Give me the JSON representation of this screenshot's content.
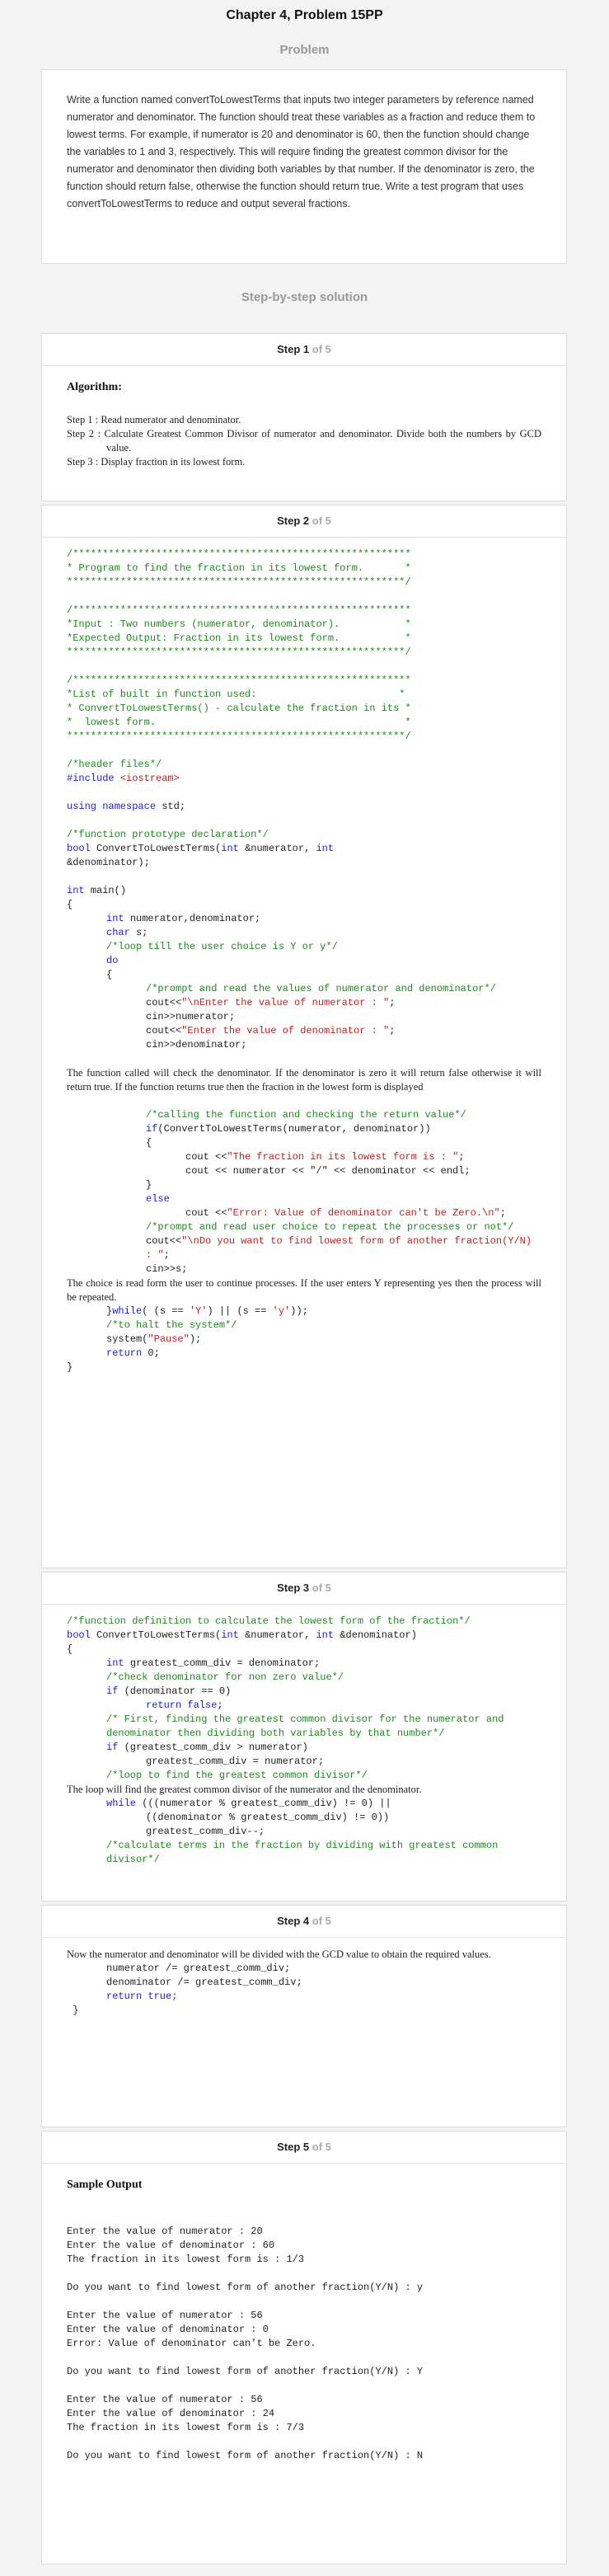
{
  "page_title": "Chapter 4, Problem 15PP",
  "problem_heading": "Problem",
  "problem_text": "Write a function named convertToLowestTerms that inputs two integer parameters by reference named numerator and denominator. The function should treat these variables as a fraction and reduce them to lowest terms. For example, if numerator is 20 and denominator is 60, then the function should change the variables to 1 and 3, respectively. This will require finding the greatest common divisor for the numerator and denominator then dividing both variables by that number. If the denominator is zero, the function should return false, otherwise the function should return true. Write a test program that uses convertToLowestTerms to reduce and output several fractions.",
  "solution_heading": "Step-by-step solution",
  "step_label": "Step",
  "steps": [
    {
      "number": "1",
      "of": "of 5",
      "blocks": [
        {
          "kind": "heading",
          "text": "Algorithm:"
        },
        {
          "kind": "gap"
        },
        {
          "kind": "para",
          "text": "Step 1 : Read numerator and denominator."
        },
        {
          "kind": "para",
          "text": "Step 2 : Calculate Greatest Common Divisor of numerator and denominator. Divide both the numbers by GCD value.",
          "hang": true
        },
        {
          "kind": "para",
          "text": "Step 3 : Display fraction in its lowest form."
        }
      ]
    },
    {
      "number": "2",
      "of": "of 5",
      "blocks": [
        {
          "kind": "code",
          "cls": "c",
          "text": "/*********************************************************"
        },
        {
          "kind": "code",
          "cls": "c",
          "text": "* Program to find the fraction in its lowest form.       *"
        },
        {
          "kind": "code",
          "cls": "c",
          "text": "*********************************************************/"
        },
        {
          "kind": "gap"
        },
        {
          "kind": "code",
          "cls": "c",
          "text": "/*********************************************************"
        },
        {
          "kind": "code",
          "cls": "c",
          "text": "*Input : Two numbers (numerator, denominator).           *"
        },
        {
          "kind": "code",
          "cls": "c",
          "text": "*Expected Output: Fraction in its lowest form.           *"
        },
        {
          "kind": "code",
          "cls": "c",
          "text": "*********************************************************/"
        },
        {
          "kind": "gap"
        },
        {
          "kind": "code",
          "cls": "c",
          "text": "/*********************************************************"
        },
        {
          "kind": "code",
          "cls": "c",
          "text": "*List of built in function used:                        *"
        },
        {
          "kind": "code",
          "cls": "c",
          "text": "* ConvertToLowestTerms() - calculate the fraction in its *"
        },
        {
          "kind": "code",
          "cls": "c",
          "text": "*  lowest form.                                          *"
        },
        {
          "kind": "code",
          "cls": "c",
          "text": "*********************************************************/"
        },
        {
          "kind": "gap"
        },
        {
          "kind": "code",
          "cls": "c",
          "text": "/*header files*/"
        },
        {
          "kind": "code",
          "segs": [
            {
              "cls": "k",
              "text": "#include "
            },
            {
              "cls": "s",
              "text": "<iostream>"
            }
          ]
        },
        {
          "kind": "gap"
        },
        {
          "kind": "code",
          "segs": [
            {
              "cls": "k",
              "text": "using namespace "
            },
            {
              "cls": "n",
              "text": "std;"
            }
          ]
        },
        {
          "kind": "gap"
        },
        {
          "kind": "code",
          "cls": "c",
          "text": "/*function prototype declaration*/"
        },
        {
          "kind": "code",
          "segs": [
            {
              "cls": "k",
              "text": "bool "
            },
            {
              "cls": "n",
              "text": "ConvertToLowestTerms("
            },
            {
              "cls": "k",
              "text": "int "
            },
            {
              "cls": "n",
              "text": "&numerator, "
            },
            {
              "cls": "k",
              "text": "int"
            }
          ]
        },
        {
          "kind": "code",
          "cls": "n",
          "text": "&denominator);"
        },
        {
          "kind": "gap"
        },
        {
          "kind": "code",
          "segs": [
            {
              "cls": "k",
              "text": "int "
            },
            {
              "cls": "n",
              "text": "main()"
            }
          ]
        },
        {
          "kind": "code",
          "cls": "n",
          "text": "{"
        },
        {
          "kind": "code",
          "indent": 1,
          "segs": [
            {
              "cls": "k",
              "text": "int "
            },
            {
              "cls": "n",
              "text": "numerator,denominator;"
            }
          ]
        },
        {
          "kind": "code",
          "indent": 1,
          "segs": [
            {
              "cls": "k",
              "text": "char "
            },
            {
              "cls": "n",
              "text": "s;"
            }
          ]
        },
        {
          "kind": "code",
          "indent": 1,
          "cls": "c",
          "text": "/*loop till the user choice is Y or y*/"
        },
        {
          "kind": "code",
          "indent": 1,
          "cls": "k",
          "text": "do"
        },
        {
          "kind": "code",
          "indent": 1,
          "cls": "n",
          "text": "{"
        },
        {
          "kind": "code",
          "indent": 2,
          "cls": "c",
          "text": "/*prompt and read the values of numerator and denominator*/"
        },
        {
          "kind": "code",
          "indent": 2,
          "segs": [
            {
              "cls": "n",
              "text": "cout<<"
            },
            {
              "cls": "s",
              "text": "\"\\nEnter the value of numerator : \""
            },
            {
              "cls": "n",
              "text": ";"
            }
          ]
        },
        {
          "kind": "code",
          "indent": 2,
          "cls": "n",
          "text": "cin>>numerator;"
        },
        {
          "kind": "code",
          "indent": 2,
          "segs": [
            {
              "cls": "n",
              "text": "cout<<"
            },
            {
              "cls": "s",
              "text": "\"Enter the value of denominator : \""
            },
            {
              "cls": "n",
              "text": ";"
            }
          ]
        },
        {
          "kind": "code",
          "indent": 2,
          "cls": "n",
          "text": "cin>>denominator;"
        },
        {
          "kind": "gap"
        },
        {
          "kind": "para",
          "text": "The function called will check the denominator. If the denominator is zero it will return false otherwise it will return true. If the function returns true then the fraction in the lowest form is displayed"
        },
        {
          "kind": "gap"
        },
        {
          "kind": "code",
          "indent": 2,
          "cls": "c",
          "text": "/*calling the function and checking the return value*/"
        },
        {
          "kind": "code",
          "indent": 2,
          "segs": [
            {
              "cls": "k",
              "text": "if"
            },
            {
              "cls": "n",
              "text": "(ConvertToLowestTerms(numerator, denominator))"
            }
          ]
        },
        {
          "kind": "code",
          "indent": 2,
          "cls": "n",
          "text": "{"
        },
        {
          "kind": "code",
          "indent": 3,
          "segs": [
            {
              "cls": "n",
              "text": "cout <<"
            },
            {
              "cls": "s",
              "text": "\"The fraction in its lowest form is : \""
            },
            {
              "cls": "n",
              "text": ";"
            }
          ]
        },
        {
          "kind": "code",
          "indent": 3,
          "cls": "n",
          "text": "cout << numerator << \"/\" << denominator << endl;"
        },
        {
          "kind": "code",
          "indent": 2,
          "cls": "n",
          "text": "}"
        },
        {
          "kind": "code",
          "indent": 2,
          "cls": "k",
          "text": "else"
        },
        {
          "kind": "code",
          "indent": 3,
          "segs": [
            {
              "cls": "n",
              "text": "cout <<"
            },
            {
              "cls": "s",
              "text": "\"Error: Value of denominator can't be Zero.\\n\""
            },
            {
              "cls": "n",
              "text": ";"
            }
          ]
        },
        {
          "kind": "code",
          "indent": 2,
          "cls": "c",
          "text": "/*prompt and read user choice to repeat the processes or not*/"
        },
        {
          "kind": "code",
          "indent": 2,
          "segs": [
            {
              "cls": "n",
              "text": "cout<<"
            },
            {
              "cls": "s",
              "text": "\"\\nDo you want to find lowest form of another fraction(Y/N) : \""
            },
            {
              "cls": "n",
              "text": ";"
            }
          ]
        },
        {
          "kind": "code",
          "indent": 2,
          "cls": "n",
          "text": "cin>>s;"
        },
        {
          "kind": "para",
          "text": "The choice is read form the user to continue processes. If the user enters Y representing yes then the process will be repeated."
        },
        {
          "kind": "code",
          "indent": 1,
          "segs": [
            {
              "cls": "n",
              "text": "}"
            },
            {
              "cls": "k",
              "text": "while"
            },
            {
              "cls": "n",
              "text": "( (s == "
            },
            {
              "cls": "s",
              "text": "'Y'"
            },
            {
              "cls": "n",
              "text": ") || (s == "
            },
            {
              "cls": "s",
              "text": "'y'"
            },
            {
              "cls": "n",
              "text": "));"
            }
          ]
        },
        {
          "kind": "code",
          "indent": 1,
          "cls": "c",
          "text": "/*to halt the system*/"
        },
        {
          "kind": "code",
          "indent": 1,
          "segs": [
            {
              "cls": "n",
              "text": "system("
            },
            {
              "cls": "s",
              "text": "\"Pause\""
            },
            {
              "cls": "n",
              "text": ");"
            }
          ]
        },
        {
          "kind": "code",
          "indent": 1,
          "segs": [
            {
              "cls": "k",
              "text": "return "
            },
            {
              "cls": "n",
              "text": "0;"
            }
          ]
        },
        {
          "kind": "code",
          "cls": "n",
          "text": "}"
        }
      ]
    },
    {
      "number": "3",
      "of": "of 5",
      "blocks": [
        {
          "kind": "code",
          "cls": "c",
          "text": "/*function definition to calculate the lowest form of the fraction*/"
        },
        {
          "kind": "code",
          "segs": [
            {
              "cls": "k",
              "text": "bool "
            },
            {
              "cls": "n",
              "text": "ConvertToLowestTerms("
            },
            {
              "cls": "k",
              "text": "int "
            },
            {
              "cls": "n",
              "text": "&numerator, "
            },
            {
              "cls": "k",
              "text": "int "
            },
            {
              "cls": "n",
              "text": "&denominator)"
            }
          ]
        },
        {
          "kind": "code",
          "cls": "n",
          "text": "{"
        },
        {
          "kind": "code",
          "indent": 1,
          "segs": [
            {
              "cls": "k",
              "text": "int "
            },
            {
              "cls": "n",
              "text": "greatest_comm_div = denominator;"
            }
          ]
        },
        {
          "kind": "code",
          "indent": 1,
          "cls": "c",
          "text": "/*check denominator for non zero value*/"
        },
        {
          "kind": "code",
          "indent": 1,
          "segs": [
            {
              "cls": "k",
              "text": "if "
            },
            {
              "cls": "n",
              "text": "(denominator == 0)"
            }
          ]
        },
        {
          "kind": "code",
          "indent": 2,
          "cls": "k",
          "text": "return false;"
        },
        {
          "kind": "code",
          "indent": 1,
          "cls": "c",
          "text": "/* First, finding the greatest common divisor for the numerator and denominator then dividing both variables by that number*/"
        },
        {
          "kind": "code",
          "indent": 1,
          "segs": [
            {
              "cls": "k",
              "text": "if "
            },
            {
              "cls": "n",
              "text": "(greatest_comm_div > numerator)"
            }
          ]
        },
        {
          "kind": "code",
          "indent": 2,
          "cls": "n",
          "text": "greatest_comm_div = numerator;"
        },
        {
          "kind": "code",
          "indent": 1,
          "cls": "c",
          "text": "/*loop to find the greatest common divisor*/"
        },
        {
          "kind": "para",
          "text": "The loop will find the greatest common divisor of the numerator and the denominator."
        },
        {
          "kind": "code",
          "indent": 1,
          "segs": [
            {
              "cls": "k",
              "text": "while "
            },
            {
              "cls": "n",
              "text": "(((numerator % greatest_comm_div) != 0) ||"
            }
          ]
        },
        {
          "kind": "code",
          "indent": 2,
          "cls": "n",
          "text": "((denominator % greatest_comm_div) != 0))"
        },
        {
          "kind": "code",
          "indent": 2,
          "cls": "n",
          "text": "greatest_comm_div--;"
        },
        {
          "kind": "code",
          "indent": 1,
          "cls": "c",
          "text": "/*calculate terms in the fraction by dividing with greatest common divisor*/"
        }
      ]
    },
    {
      "number": "4",
      "of": "of 5",
      "blocks": [
        {
          "kind": "para",
          "text": "Now the numerator and denominator will be divided with the GCD value to obtain the required values."
        },
        {
          "kind": "code",
          "indent": 1,
          "cls": "n",
          "text": "numerator /= greatest_comm_div;"
        },
        {
          "kind": "code",
          "indent": 1,
          "cls": "n",
          "text": "denominator /= greatest_comm_div;"
        },
        {
          "kind": "code",
          "indent": 1,
          "cls": "k",
          "text": "return true;"
        },
        {
          "kind": "code",
          "cls": "n",
          "text": " }"
        }
      ]
    },
    {
      "number": "5",
      "of": "of 5",
      "blocks": [
        {
          "kind": "heading",
          "text": "Sample Output"
        },
        {
          "kind": "gap"
        },
        {
          "kind": "gap"
        },
        {
          "kind": "code",
          "cls": "n",
          "text": "Enter the value of numerator : 20"
        },
        {
          "kind": "code",
          "cls": "n",
          "text": "Enter the value of denominator : 60"
        },
        {
          "kind": "code",
          "cls": "n",
          "text": "The fraction in its lowest form is : 1/3"
        },
        {
          "kind": "gap"
        },
        {
          "kind": "code",
          "cls": "n",
          "text": "Do you want to find lowest form of another fraction(Y/N) : y"
        },
        {
          "kind": "gap"
        },
        {
          "kind": "code",
          "cls": "n",
          "text": "Enter the value of numerator : 56"
        },
        {
          "kind": "code",
          "cls": "n",
          "text": "Enter the value of denominator : 0"
        },
        {
          "kind": "code",
          "cls": "n",
          "text": "Error: Value of denominator can't be Zero."
        },
        {
          "kind": "gap"
        },
        {
          "kind": "code",
          "cls": "n",
          "text": "Do you want to find lowest form of another fraction(Y/N) : Y"
        },
        {
          "kind": "gap"
        },
        {
          "kind": "code",
          "cls": "n",
          "text": "Enter the value of numerator : 56"
        },
        {
          "kind": "code",
          "cls": "n",
          "text": "Enter the value of denominator : 24"
        },
        {
          "kind": "code",
          "cls": "n",
          "text": "The fraction in its lowest form is : 7/3"
        },
        {
          "kind": "gap"
        },
        {
          "kind": "code",
          "cls": "n",
          "text": "Do you want to find lowest form of another fraction(Y/N) : N"
        }
      ]
    }
  ]
}
